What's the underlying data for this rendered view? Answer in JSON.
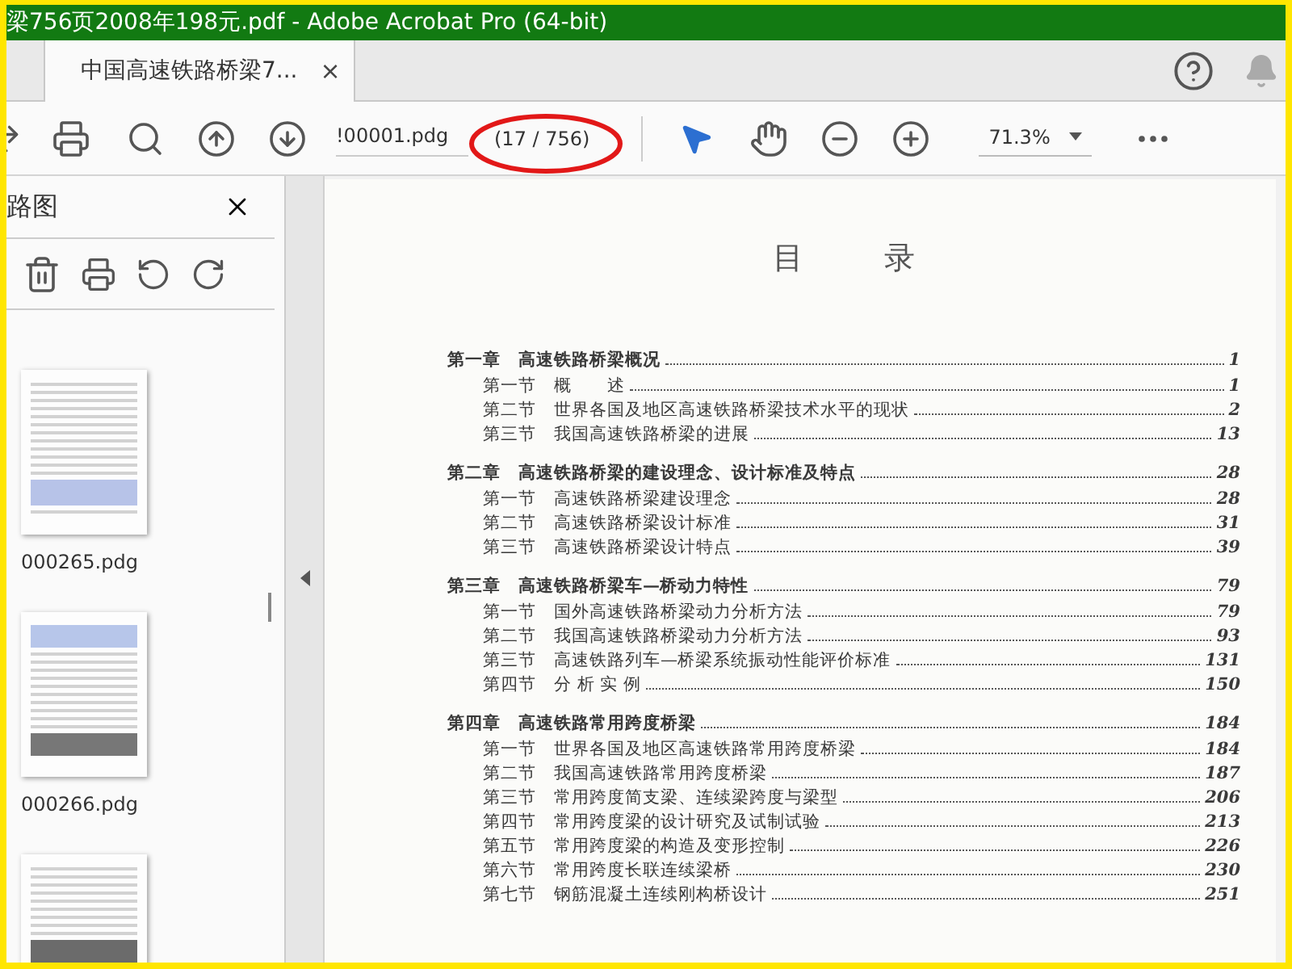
{
  "window": {
    "title": "梁756页2008年198元.pdf - Adobe Acrobat Pro (64-bit)"
  },
  "tabs": [
    {
      "label": "中国高速铁路桥梁7...",
      "selected": true,
      "close": "×"
    }
  ],
  "toolbar": {
    "page_field": {
      "value": "!00001.pdg"
    },
    "page_count": "(17 / 756)",
    "zoom": {
      "value": "71.3%"
    }
  },
  "sidebar": {
    "title": "路图",
    "thumbnails": [
      {
        "label": "000265.pdg",
        "kind": "table"
      },
      {
        "label": "000266.pdg",
        "kind": "figure"
      },
      {
        "kind": "photo"
      }
    ]
  },
  "document": {
    "title": "目 录",
    "chapters": [
      {
        "label": "第一章",
        "title": "高速铁路桥梁概况",
        "page": "1",
        "sections": [
          {
            "label": "第一节",
            "title": "概　　述",
            "page": "1"
          },
          {
            "label": "第二节",
            "title": "世界各国及地区高速铁路桥梁技术水平的现状",
            "page": "2"
          },
          {
            "label": "第三节",
            "title": "我国高速铁路桥梁的进展",
            "page": "13"
          }
        ]
      },
      {
        "label": "第二章",
        "title": "高速铁路桥梁的建设理念、设计标准及特点",
        "page": "28",
        "sections": [
          {
            "label": "第一节",
            "title": "高速铁路桥梁建设理念",
            "page": "28"
          },
          {
            "label": "第二节",
            "title": "高速铁路桥梁设计标准",
            "page": "31"
          },
          {
            "label": "第三节",
            "title": "高速铁路桥梁设计特点",
            "page": "39"
          }
        ]
      },
      {
        "label": "第三章",
        "title": "高速铁路桥梁车—桥动力特性",
        "page": "79",
        "sections": [
          {
            "label": "第一节",
            "title": "国外高速铁路桥梁动力分析方法",
            "page": "79"
          },
          {
            "label": "第二节",
            "title": "我国高速铁路桥梁动力分析方法",
            "page": "93"
          },
          {
            "label": "第三节",
            "title": "高速铁路列车—桥梁系统振动性能评价标准",
            "page": "131"
          },
          {
            "label": "第四节",
            "title": "分 析 实 例",
            "page": "150"
          }
        ]
      },
      {
        "label": "第四章",
        "title": "高速铁路常用跨度桥梁",
        "page": "184",
        "sections": [
          {
            "label": "第一节",
            "title": "世界各国及地区高速铁路常用跨度桥梁",
            "page": "184"
          },
          {
            "label": "第二节",
            "title": "我国高速铁路常用跨度桥梁",
            "page": "187"
          },
          {
            "label": "第三节",
            "title": "常用跨度简支梁、连续梁跨度与梁型",
            "page": "206"
          },
          {
            "label": "第四节",
            "title": "常用跨度梁的设计研究及试制试验",
            "page": "213"
          },
          {
            "label": "第五节",
            "title": "常用跨度梁的构造及变形控制",
            "page": "226"
          },
          {
            "label": "第六节",
            "title": "常用跨度长联连续梁桥",
            "page": "230"
          },
          {
            "label": "第七节",
            "title": "钢筋混凝土连续刚构桥设计",
            "page": "251"
          }
        ]
      }
    ]
  }
}
